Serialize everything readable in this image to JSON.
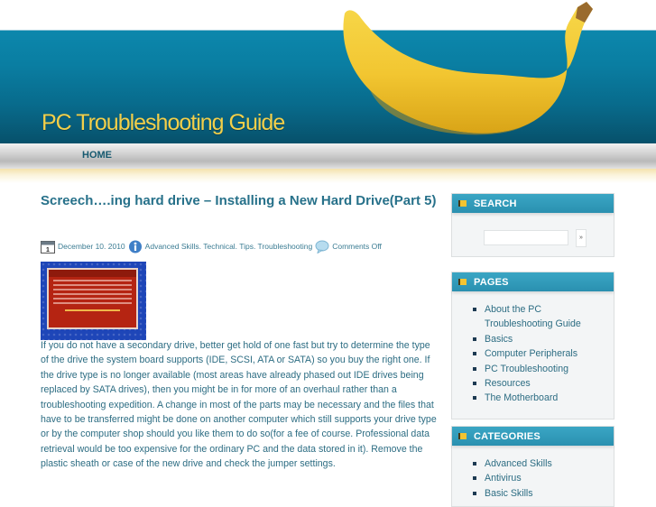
{
  "site": {
    "title": "PC Troubleshooting Guide"
  },
  "nav": {
    "items": [
      {
        "label": "HOME"
      }
    ]
  },
  "post": {
    "title": "Screech….ing hard drive – Installing a New Hard Drive(Part 5)",
    "meta": {
      "date_icon": "calendar-icon",
      "date": "December 10. 2010",
      "category_icon": "info-icon",
      "categories": "Advanced Skills. Technical. Tips. Troubleshooting",
      "comments_icon": "speech-bubble-icon",
      "comments": "Comments Off"
    },
    "thumbnail": {
      "description": "Blue screen with red error dialog"
    },
    "body": "If you do not have a secondary drive, better get hold of one fast but try to determine the type of the drive the system board supports (IDE, SCSI, ATA or SATA) so you buy the right one. If the drive type is no longer available (most areas have already phased out IDE drives being replaced by SATA drives), then you might be in for more of an overhaul rather than a troubleshooting expedition. A change in most of the parts may be necessary and the files that have to be transferred might be done on another computer which still supports your drive type or by the computer shop should you like them to do so(for a fee of course. Professional data retrieval would be too expensive for the ordinary PC and the data stored in it). Remove the plastic sheath or case of the new drive and check the jumper settings."
  },
  "sidebar": {
    "search": {
      "title": "SEARCH",
      "input_value": "",
      "button_label": "»"
    },
    "pages": {
      "title": "PAGES",
      "items": [
        {
          "label": "About the PC Troubleshooting Guide"
        },
        {
          "label": "Basics"
        },
        {
          "label": "Computer Peripherals"
        },
        {
          "label": "PC Troubleshooting"
        },
        {
          "label": "Resources"
        },
        {
          "label": "The Motherboard"
        }
      ]
    },
    "categories": {
      "title": "CATEGORIES",
      "items": [
        {
          "label": "Advanced Skills"
        },
        {
          "label": "Antivirus"
        },
        {
          "label": "Basic Skills"
        }
      ]
    }
  },
  "colors": {
    "header_blue": "#0a7ea2",
    "title_yellow": "#f2cf4a",
    "link_teal": "#27718a",
    "widget_head": "#3aa6c4",
    "bullet_square": "#f2c431"
  }
}
